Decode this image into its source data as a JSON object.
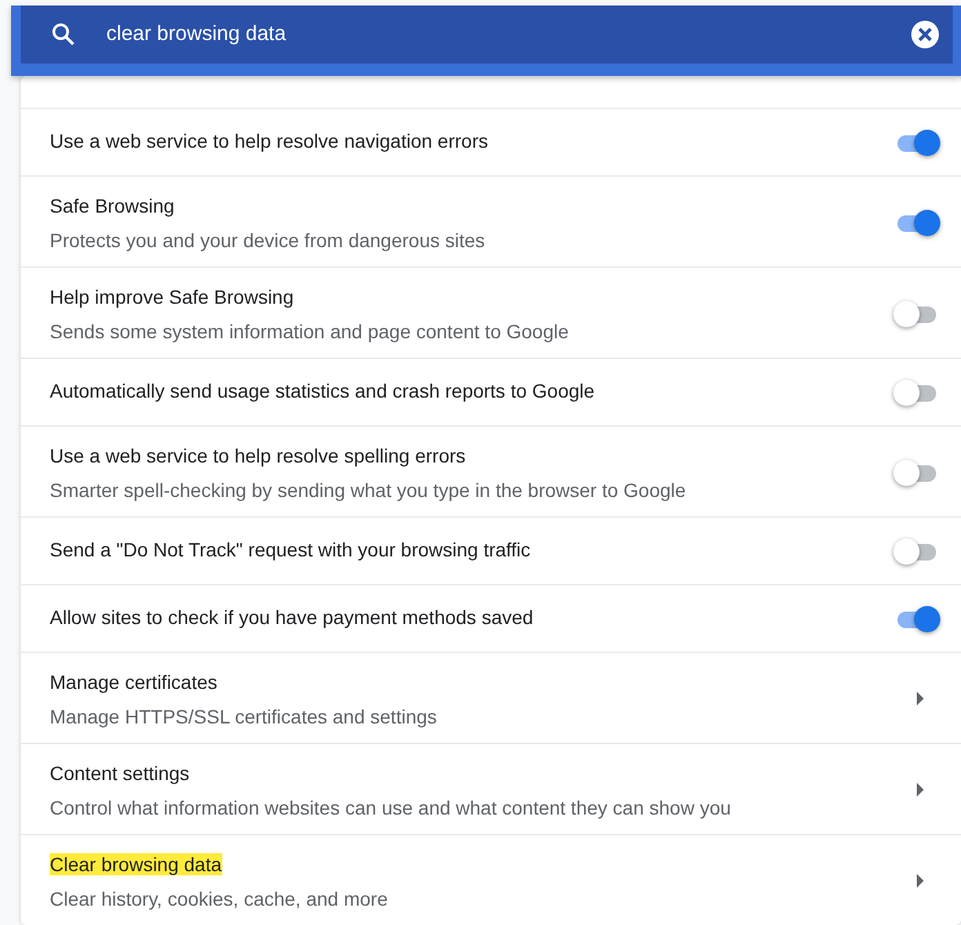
{
  "search": {
    "value": "clear browsing data"
  },
  "settings": [
    {
      "kind": "toggle",
      "title": "Use a web service to help resolve navigation errors",
      "on": true
    },
    {
      "kind": "toggle",
      "title": "Safe Browsing",
      "subtitle": "Protects you and your device from dangerous sites",
      "on": true
    },
    {
      "kind": "toggle",
      "title": "Help improve Safe Browsing",
      "subtitle": "Sends some system information and page content to Google",
      "on": false
    },
    {
      "kind": "toggle",
      "title": "Automatically send usage statistics and crash reports to Google",
      "on": false
    },
    {
      "kind": "toggle",
      "title": "Use a web service to help resolve spelling errors",
      "subtitle": "Smarter spell-checking by sending what you type in the browser to Google",
      "on": false
    },
    {
      "kind": "toggle",
      "title": "Send a \"Do Not Track\" request with your browsing traffic",
      "on": false
    },
    {
      "kind": "toggle",
      "title": "Allow sites to check if you have payment methods saved",
      "on": true
    },
    {
      "kind": "link",
      "title": "Manage certificates",
      "subtitle": "Manage HTTPS/SSL certificates and settings",
      "highlighted": false
    },
    {
      "kind": "link",
      "title": "Content settings",
      "subtitle": "Control what information websites can use and what content they can show you",
      "highlighted": false
    },
    {
      "kind": "link",
      "title": "Clear browsing data",
      "subtitle": "Clear history, cookies, cache, and more",
      "highlighted": true
    }
  ]
}
